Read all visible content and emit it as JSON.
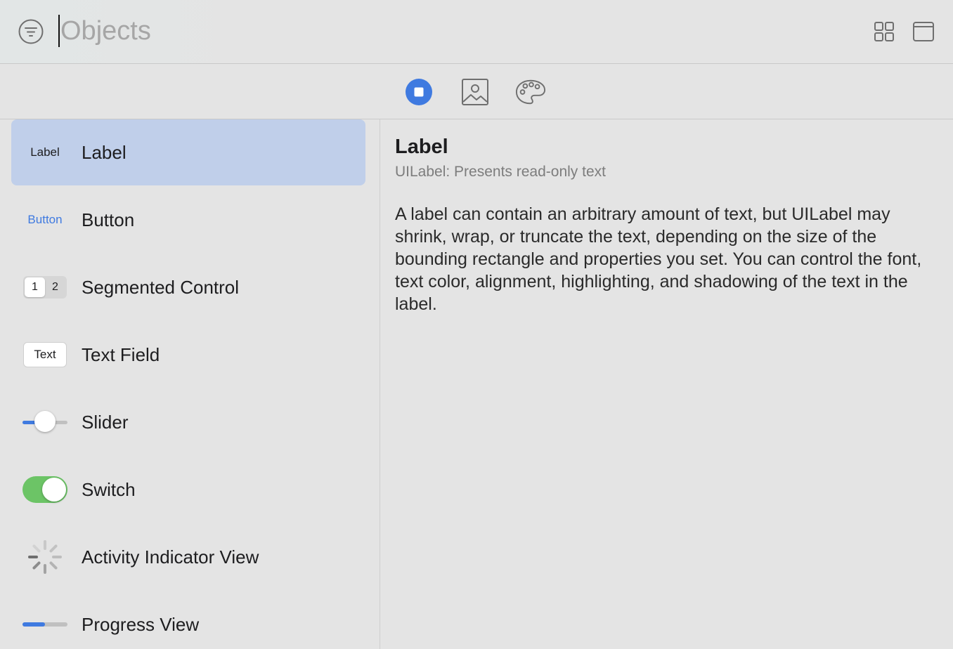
{
  "search": {
    "placeholder": "Objects",
    "value": ""
  },
  "icons": {
    "filter": "filter-circle-icon",
    "grid": "grid-view-icon",
    "window": "window-icon"
  },
  "tabs": [
    {
      "name": "objects-library",
      "icon": "stop-circle-icon",
      "selected": true
    },
    {
      "name": "media-library",
      "icon": "image-icon",
      "selected": false
    },
    {
      "name": "color-library",
      "icon": "palette-icon",
      "selected": false
    }
  ],
  "items": [
    {
      "label": "Label",
      "thumb": "Label",
      "selected": true
    },
    {
      "label": "Button",
      "thumb": "Button",
      "selected": false
    },
    {
      "label": "Segmented Control",
      "thumb_segments": [
        "1",
        "2"
      ],
      "selected": false
    },
    {
      "label": "Text Field",
      "thumb": "Text",
      "selected": false
    },
    {
      "label": "Slider",
      "slider_value": 0.5,
      "selected": false
    },
    {
      "label": "Switch",
      "switch_on": true,
      "selected": false
    },
    {
      "label": "Activity Indicator View",
      "thumb_icon": "activity-spinner-icon",
      "selected": false
    },
    {
      "label": "Progress View",
      "progress_value": 0.5,
      "selected": false
    }
  ],
  "detail": {
    "title": "Label",
    "subtitle": "UILabel: Presents read-only text",
    "description": "A label can contain an arbitrary amount of text, but UILabel may shrink, wrap, or truncate the text, depending on the size of the bounding rectangle and properties you set. You can control the font, text color, alignment, highlighting, and shadowing of the text in the label."
  },
  "colors": {
    "accent": "#3f7ae0",
    "selection": "#c0cfea",
    "switch_on": "#6cc466",
    "background": "#e4e4e4"
  }
}
